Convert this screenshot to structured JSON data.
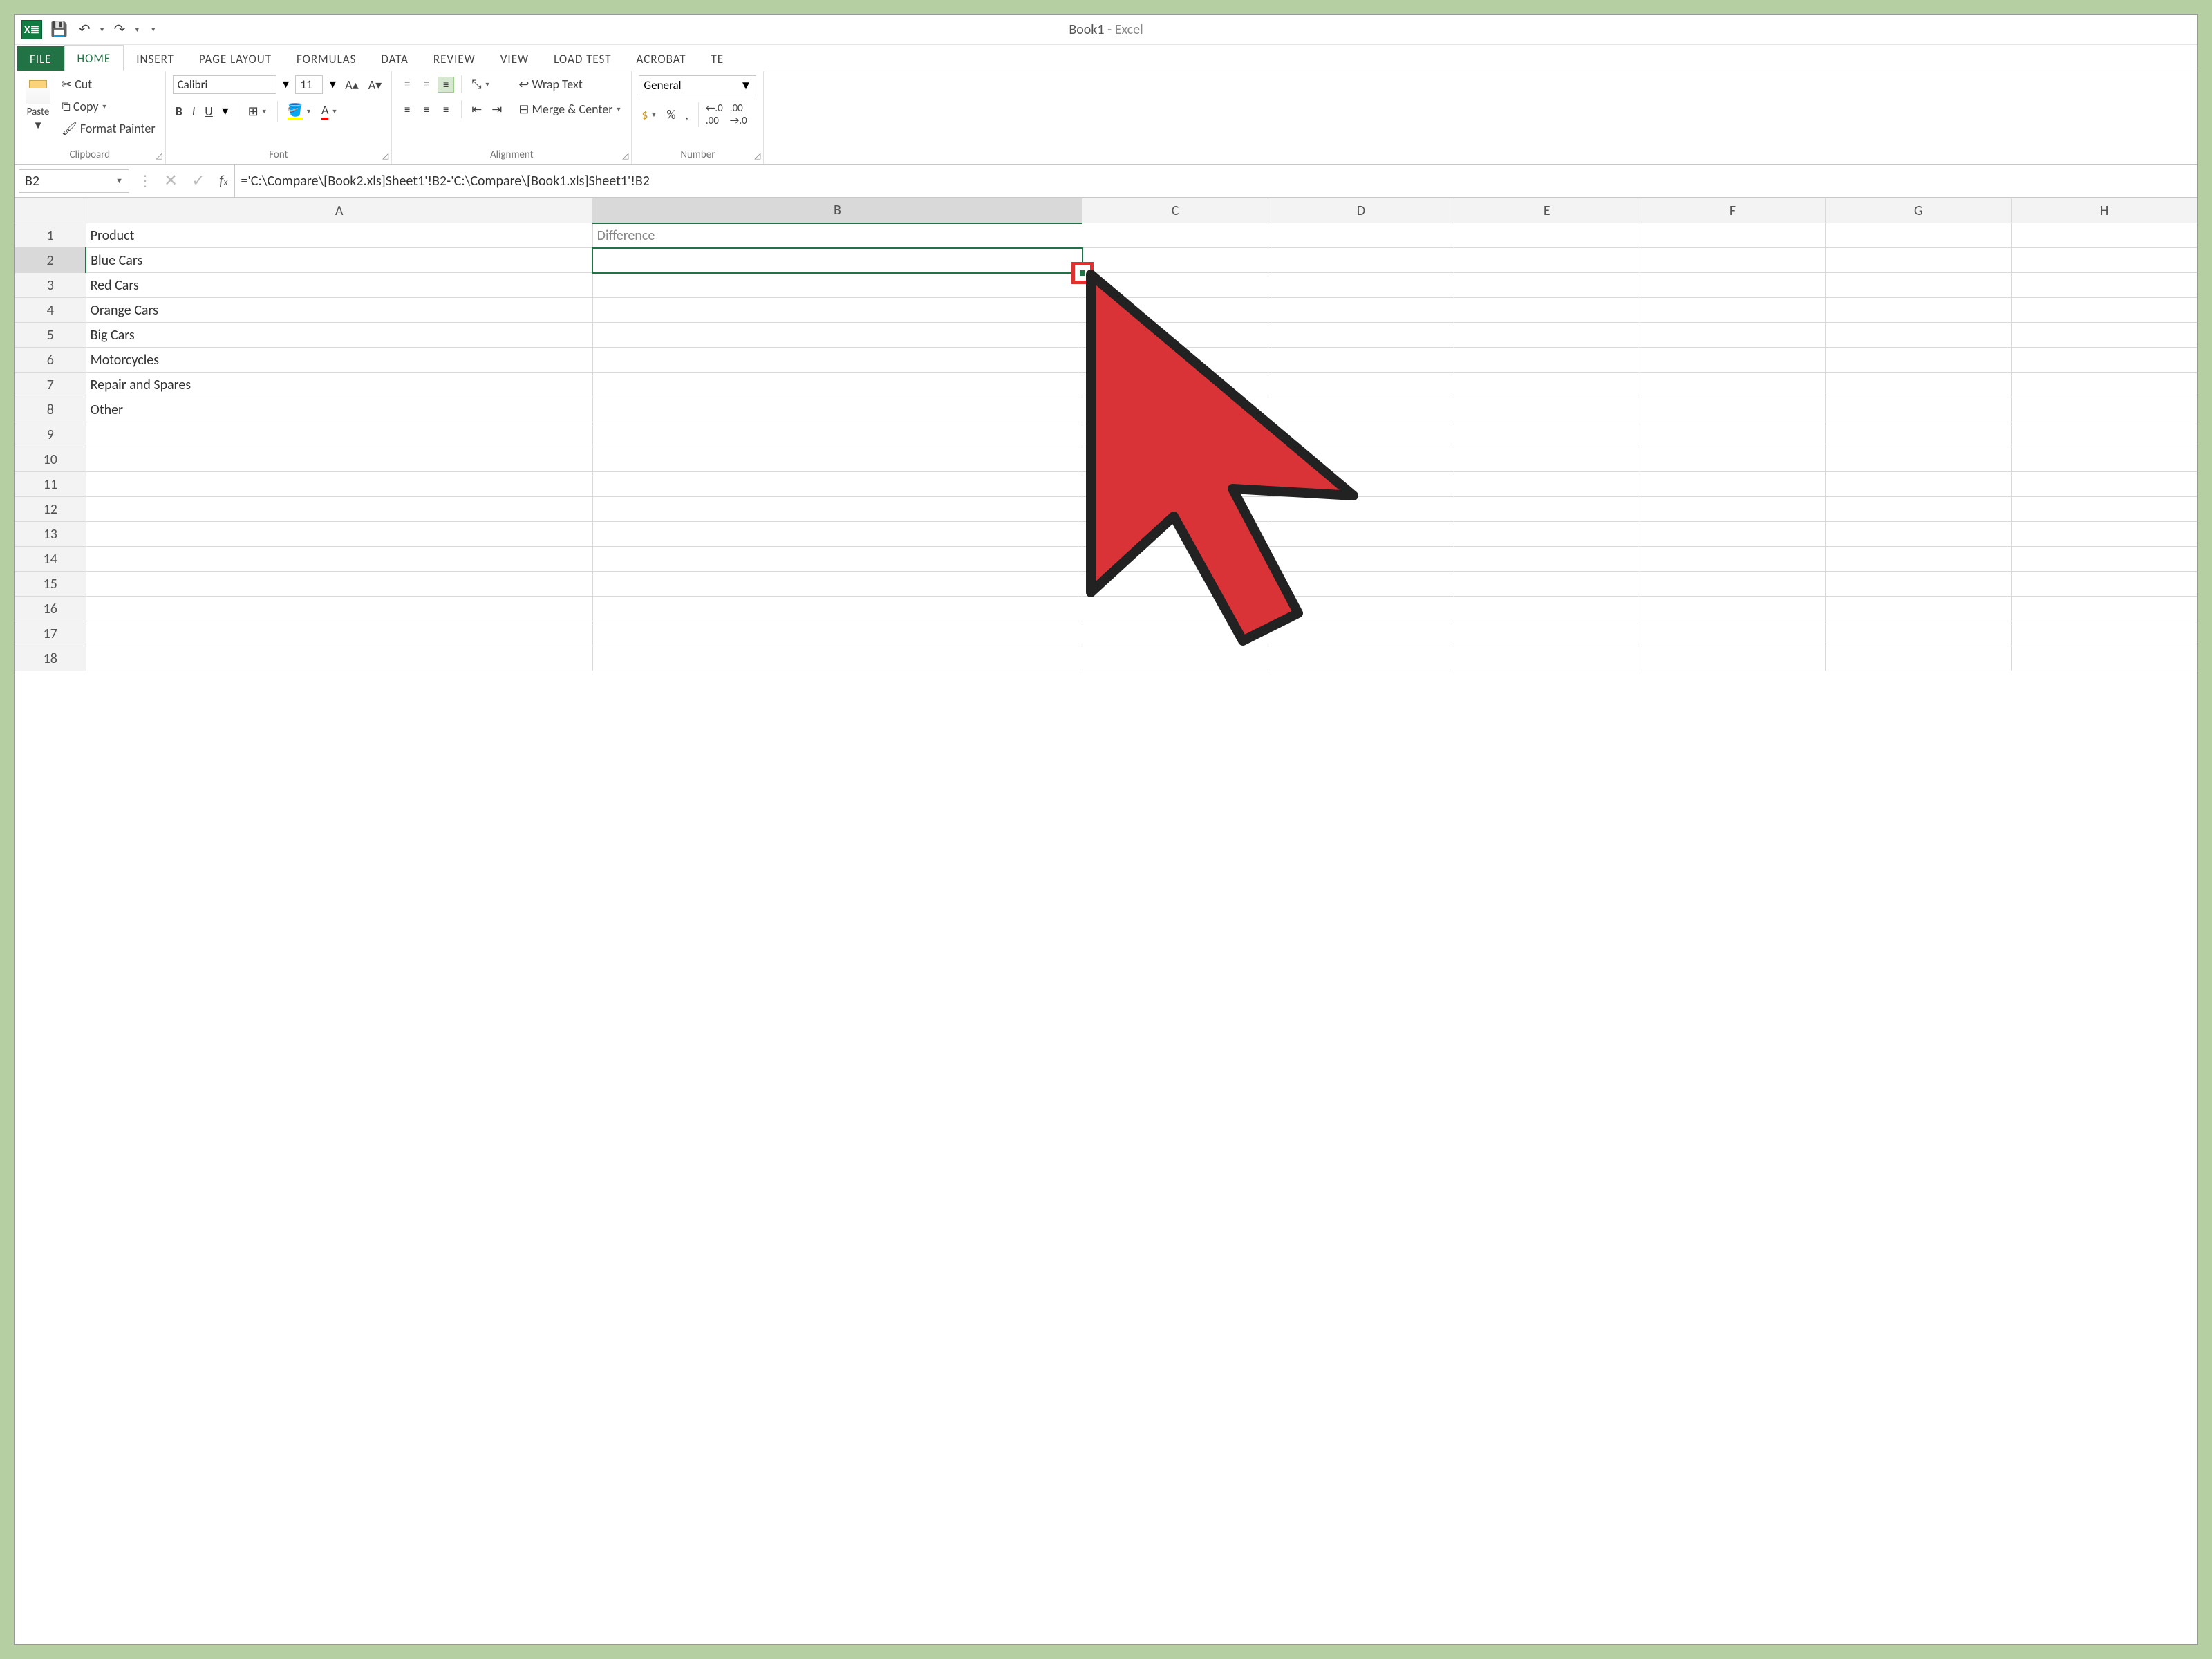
{
  "app": {
    "title_book": "Book1",
    "title_sep": " - ",
    "title_app": "Excel"
  },
  "qat": {
    "save": "💾",
    "undo": "↶",
    "redo": "↷"
  },
  "tabs": {
    "file": "FILE",
    "home": "HOME",
    "insert": "INSERT",
    "page_layout": "PAGE LAYOUT",
    "formulas": "FORMULAS",
    "data": "DATA",
    "review": "REVIEW",
    "view": "VIEW",
    "load_test": "LOAD TEST",
    "acrobat": "ACROBAT",
    "te": "TE"
  },
  "ribbon": {
    "clipboard": {
      "paste": "Paste",
      "cut": "Cut",
      "copy": "Copy",
      "format_painter": "Format Painter",
      "label": "Clipboard"
    },
    "font": {
      "name": "Calibri",
      "size": "11",
      "bold": "B",
      "italic": "I",
      "underline": "U",
      "label": "Font"
    },
    "alignment": {
      "wrap": "Wrap Text",
      "merge": "Merge & Center",
      "label": "Alignment"
    },
    "number": {
      "format": "General",
      "label": "Number"
    }
  },
  "formula_bar": {
    "cell_ref": "B2",
    "formula": "='C:\\Compare\\[Book2.xls]Sheet1'!B2-'C:\\Compare\\[Book1.xls]Sheet1'!B2"
  },
  "grid": {
    "columns": [
      "A",
      "B",
      "C",
      "D",
      "E",
      "F",
      "G",
      "H"
    ],
    "headers": {
      "A": "Product",
      "B": "Difference"
    },
    "colA_values": [
      "Blue Cars",
      "Red Cars",
      "Orange Cars",
      "Big Cars",
      "Motorcycles",
      "Repair and Spares",
      "Other"
    ],
    "row_count": 18,
    "active_cell": "B2",
    "selected_col": "B",
    "selected_row": 2
  }
}
